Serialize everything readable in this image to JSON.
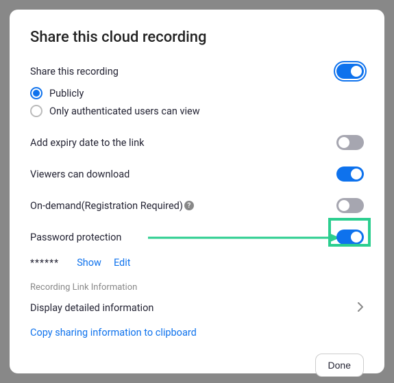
{
  "title": "Share this cloud recording",
  "share": {
    "enabled": true,
    "label": "Share this recording",
    "publicly_label": "Publicly",
    "authenticated_label": "Only authenticated users can view",
    "selected": "publicly"
  },
  "expiry": {
    "label": "Add expiry date to the link",
    "enabled": false
  },
  "download": {
    "label": "Viewers can download",
    "enabled": true
  },
  "ondemand": {
    "label": "On-demand(Registration Required)",
    "enabled": false
  },
  "password": {
    "label": "Password protection",
    "enabled": true,
    "masked": "******",
    "show_label": "Show",
    "edit_label": "Edit"
  },
  "link_info": {
    "heading": "Recording Link Information",
    "detail_label": "Display detailed information",
    "copy_label": "Copy sharing information to clipboard"
  },
  "done_label": "Done"
}
